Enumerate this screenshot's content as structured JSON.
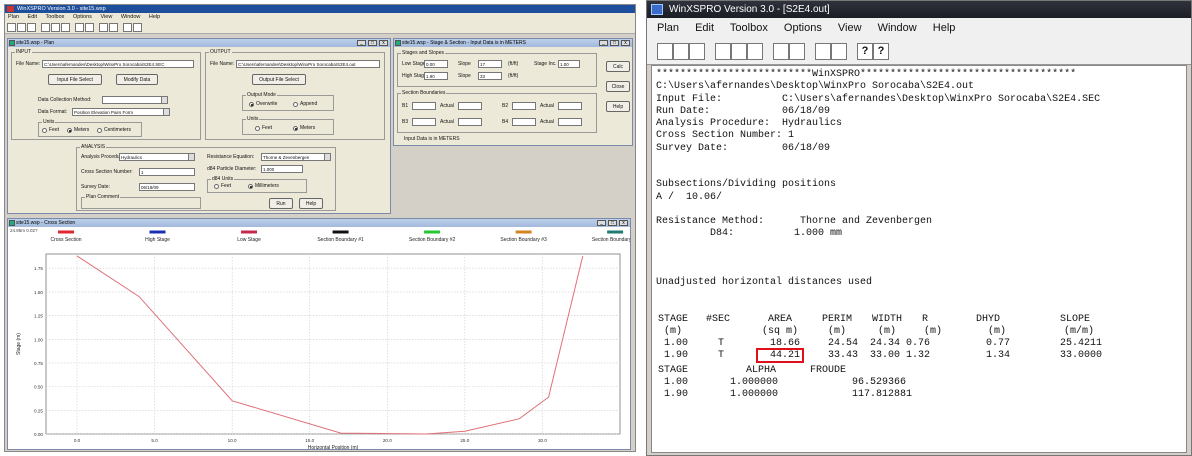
{
  "left_app": {
    "title": "WinXSPRO Version 3.0 - site15.wsp",
    "menu": [
      "Plan",
      "Edit",
      "Toolbox",
      "Options",
      "View",
      "Window",
      "Help"
    ],
    "plan_window": {
      "title": "site15.wsp - Plan",
      "input_group": "INPUT",
      "file_name_label": "File Name:",
      "file_name_value": "C:\\Users\\afernandes\\Desktop\\WinxPro Sorocaba\\S2E4.SEC",
      "input_file_select": "Input File Select",
      "modify_data": "Modify Data",
      "data_collection_label": "Data Collection Method:",
      "data_format_label": "Data Format:",
      "data_format_value": "Position Elevation Pairs Form",
      "units_group": "Units",
      "units_feet": "Feet",
      "units_meters": "Meters",
      "units_centimeters": "Centimeters",
      "output_group": "OUTPUT",
      "out_file_label": "File Name:",
      "out_file_value": "C:\\Users\\afernandes\\Desktop\\WinxPro Sorocaba\\S2E4.out",
      "output_file_select": "Output File Select",
      "output_mode_group": "Output Mode",
      "overwrite": "Overwrite",
      "append": "Append",
      "out_units_group": "Units",
      "out_feet": "Feet",
      "out_meters": "Meters",
      "analysis_group": "ANALYSIS",
      "analysis_procedure_label": "Analysis Procedure:",
      "analysis_procedure_value": "Hydraulics",
      "cross_section_label": "Cross Section Number:",
      "cross_section_value": "1",
      "survey_date_label": "Survey Date:",
      "survey_date_value": "06/18/09",
      "plan_comment_group": "Plan Comment",
      "resistance_label": "Resistance Equation:",
      "resistance_value": "Thorne & Zevenbergen",
      "d84_label": "d84 Particle Diameter:",
      "d84_value": "1.000",
      "d84_units_group": "d84 Units",
      "d84_feet": "Feet",
      "d84_millimeters": "Millimeters",
      "run": "Run",
      "help": "Help"
    },
    "stage_window": {
      "title": "site15.wsp - Stage & Section - Input Data is in METERS",
      "stages_group": "Stages and Slopes",
      "low_stage_label": "Low Stage",
      "low_stage_value": "0.00",
      "high_stage_label": "High Stage",
      "high_stage_value": "1.90",
      "slope_label": "Slope",
      "slope1_value": "17",
      "slope2_value": "33",
      "slope_unit": "(ft/ft)",
      "stage_inc_label": "Stage Inc.",
      "stage_inc_value": "1.00",
      "boundaries_group": "Section Boundaries",
      "b1": "B1",
      "b2": "B2",
      "b3": "B3",
      "b4": "B4",
      "actual": "Actual",
      "input_note": "Input Data is in METERS",
      "calc": "Calc",
      "close": "Close",
      "help": "Help"
    },
    "cross_window": {
      "title": "site15.wsp - Cross Section",
      "corner_label": "24.85m  0.02?"
    }
  },
  "chart_data": {
    "type": "line",
    "legend": [
      {
        "name": "Cross Section",
        "color": "#e0262e"
      },
      {
        "name": "High Stage",
        "color": "#1c2fb3"
      },
      {
        "name": "Low Stage",
        "color": "#c7284f"
      },
      {
        "name": "Section Boundary #1",
        "color": "#111111"
      },
      {
        "name": "Section Boundary #2",
        "color": "#25c72f"
      },
      {
        "name": "Section Boundary #3",
        "color": "#d08422"
      },
      {
        "name": "Section Boundary #4",
        "color": "#1f7a70"
      }
    ],
    "legend_placement": "top",
    "xlabel": "Horizontal Position (m)",
    "ylabel": "Stage (m)",
    "x_ticks": [
      "0.0",
      "5.0",
      "10.0",
      "15.0",
      "20.0",
      "25.0",
      "30.0"
    ],
    "y_ticks": [
      "0.00",
      "0.25",
      "0.50",
      "0.75",
      "1.00",
      "1.25",
      "1.50",
      "1.75"
    ],
    "xlim": [
      -2,
      35
    ],
    "ylim": [
      0,
      1.9
    ],
    "grid": true,
    "series": [
      {
        "name": "Cross Section",
        "color": "#e07077",
        "x": [
          0.0,
          4.0,
          10.0,
          17.0,
          22.5,
          25.0,
          28.5,
          30.4,
          32.6
        ],
        "y": [
          1.88,
          1.45,
          0.35,
          0.01,
          0.0,
          0.03,
          0.16,
          0.39,
          1.88
        ]
      }
    ]
  },
  "right_app": {
    "title": "WinXSPRO Version 3.0 - [S2E4.out]",
    "menu": [
      "Plan",
      "Edit",
      "Toolbox",
      "Options",
      "View",
      "Window",
      "Help"
    ],
    "output": {
      "banner": "**************************WinXSPRO************************************",
      "path_line": "C:\\Users\\afernandes\\Desktop\\WinxPro Sorocaba\\S2E4.out",
      "header_lines": [
        "Input File:          C:\\Users\\afernandes\\Desktop\\WinxPro Sorocaba\\S2E4.SEC",
        "Run Date:            06/18/09",
        "Analysis Procedure:  Hydraulics",
        "Cross Section Number: 1",
        "Survey Date:         06/18/09"
      ],
      "subsections_title": "Subsections/Dividing positions",
      "subsections_value": "A /  10.06/",
      "resistance_line": "Resistance Method:      Thorne and Zevenbergen",
      "d84_line": "         D84:          1.000 mm",
      "distances_note": "Unadjusted horizontal distances used",
      "table_headers": [
        "STAGE",
        "#SEC",
        "AREA",
        "PERIM",
        "WIDTH",
        "R",
        "DHYD",
        "SLOPE"
      ],
      "table_units": [
        "(m)",
        "",
        "(sq m)",
        "(m)",
        "(m)",
        "(m)",
        "(m)",
        "(m/m)"
      ],
      "table_rows": [
        [
          "1.00",
          "T",
          "18.66",
          "24.54",
          "24.34",
          "0.76",
          "0.77",
          "25.4211"
        ],
        [
          "1.90",
          "T",
          "44.21",
          "33.43",
          "33.00",
          "1.32",
          "1.34",
          "33.0000"
        ]
      ],
      "table2_headers": [
        "STAGE",
        "ALPHA",
        "FROUDE"
      ],
      "table2_units": [
        "(m)",
        "",
        ""
      ],
      "table2_rows": [
        [
          "1.00",
          "1.000000",
          "96.529366"
        ],
        [
          "1.90",
          "1.000000",
          "117.812881"
        ]
      ],
      "highlight_color": "#e0101a"
    }
  }
}
